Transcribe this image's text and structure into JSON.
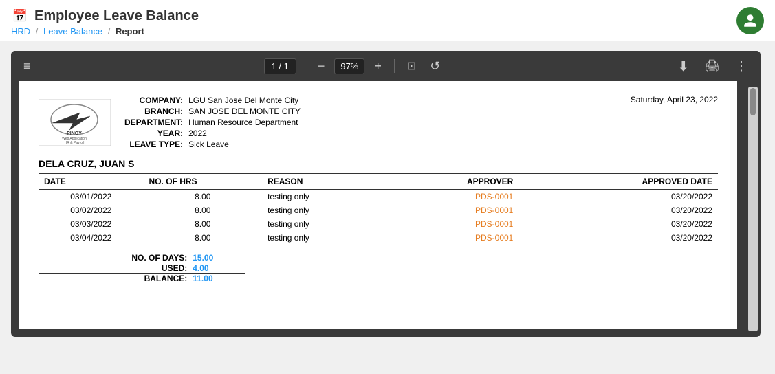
{
  "app": {
    "title": "Employee Leave Balance",
    "title_icon": "📅",
    "breadcrumb": [
      "HRD",
      "Leave Balance",
      "Report"
    ]
  },
  "avatar": {
    "icon": "person"
  },
  "pdf_toolbar": {
    "hamburger": "≡",
    "page_current": "1",
    "page_separator": "/",
    "page_total": "1",
    "zoom_minus": "−",
    "zoom_value": "97%",
    "zoom_plus": "+",
    "fit_icon": "⊡",
    "rotate_icon": "↺",
    "download_icon": "⬇",
    "print_icon": "🖨",
    "more_icon": "⋮"
  },
  "report": {
    "company_label": "COMPANY:",
    "company_value": "LGU San Jose Del Monte City",
    "branch_label": "BRANCH:",
    "branch_value": "SAN JOSE DEL MONTE CITY",
    "department_label": "DEPARTMENT:",
    "department_value": "Human Resource Department",
    "year_label": "YEAR:",
    "year_value": "2022",
    "leave_type_label": "LEAVE TYPE:",
    "leave_type_value": "Sick Leave",
    "date_printed": "Saturday, April 23, 2022",
    "employee_name": "DELA CRUZ, JUAN S"
  },
  "table": {
    "headers": [
      "DATE",
      "NO. OF HRS",
      "REASON",
      "APPROVER",
      "APPROVED DATE"
    ],
    "rows": [
      {
        "date": "03/01/2022",
        "hrs": "8.00",
        "reason": "testing only",
        "approver": "PDS-0001",
        "approved_date": "03/20/2022"
      },
      {
        "date": "03/02/2022",
        "hrs": "8.00",
        "reason": "testing only",
        "approver": "PDS-0001",
        "approved_date": "03/20/2022"
      },
      {
        "date": "03/03/2022",
        "hrs": "8.00",
        "reason": "testing only",
        "approver": "PDS-0001",
        "approved_date": "03/20/2022"
      },
      {
        "date": "03/04/2022",
        "hrs": "8.00",
        "reason": "testing only",
        "approver": "PDS-0001",
        "approved_date": "03/20/2022"
      }
    ]
  },
  "summary": {
    "no_of_days_label": "NO. OF DAYS:",
    "no_of_days_value": "15.00",
    "used_label": "USED:",
    "used_value": "4.00",
    "balance_label": "BALANCE:",
    "balance_value": "11.00"
  },
  "logo": {
    "line1": "PINOY",
    "line2": "Web Application",
    "line3": "HR & Payroll"
  }
}
